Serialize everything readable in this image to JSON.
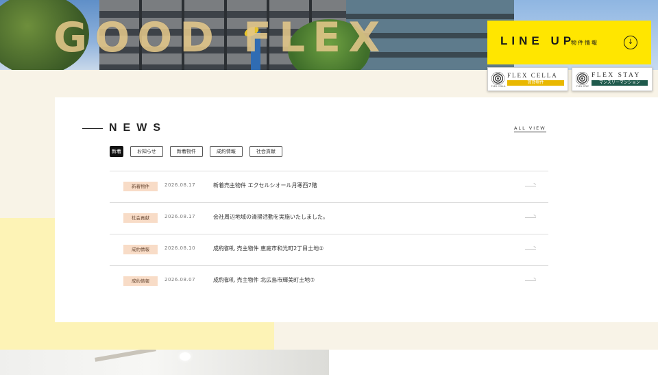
{
  "hero": {
    "logo_text": "GOOD FLEX"
  },
  "lineup": {
    "title": "LINE UP",
    "subtitle": "物件情報",
    "icon": "arrow-down-icon",
    "icon_glyph": "↓",
    "accent": "#ffe600"
  },
  "brands": [
    {
      "name": "FLEX CELLA",
      "sub": "賃貸物件",
      "emblem_caption": "FLEX CELLA",
      "color": "#e9b800"
    },
    {
      "name": "FLEX STAY",
      "sub": "マンスリーマンション",
      "emblem_caption": "FLEX STAY",
      "color": "#1f5a4c"
    }
  ],
  "news": {
    "title": "NEWS",
    "all_view": "ALL VIEW",
    "filters": [
      "新着",
      "お知らせ",
      "新着物件",
      "成約情報",
      "社会貢献"
    ],
    "active_filter": "新着",
    "items": [
      {
        "tag": "新着物件",
        "date": "2026.08.17",
        "title": "新着売主物件 エクセルシオール月寒西7階"
      },
      {
        "tag": "社会貢献",
        "date": "2026.08.17",
        "title": "会社周辺地域の清掃活動を実施いたしました。"
      },
      {
        "tag": "成約情報",
        "date": "2026.08.10",
        "title": "成約御礼 売主物件 恵庭市和光町2丁目土地②"
      },
      {
        "tag": "成約情報",
        "date": "2026.08.07",
        "title": "成約御礼 売主物件 北広島市輝美町土地⑦"
      }
    ],
    "tag_color": "#f8dcc7"
  }
}
